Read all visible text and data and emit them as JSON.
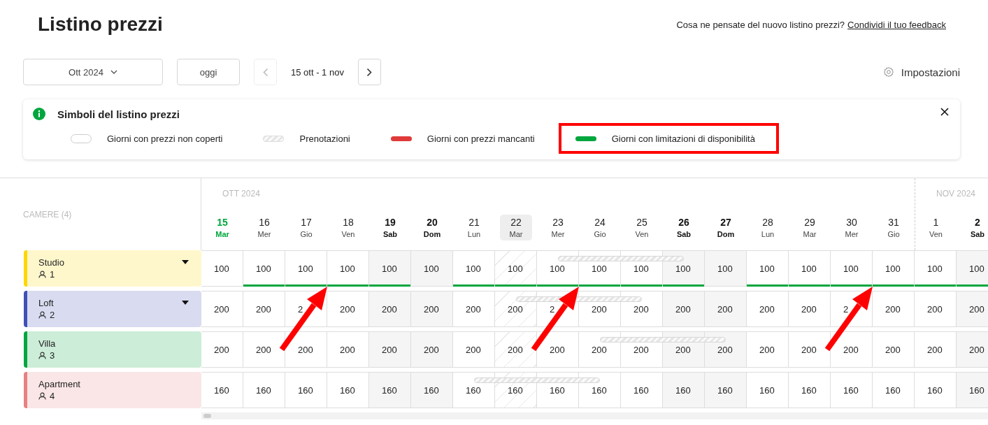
{
  "page": {
    "title": "Listino prezzi",
    "feedback_question": "Cosa ne pensate del nuovo listino prezzi?",
    "feedback_link": "Condividi il tuo feedback"
  },
  "toolbar": {
    "month": "Ott 2024",
    "today_button": "oggi",
    "prev_disabled": true,
    "range": "15 ott - 1 nov",
    "settings": "Impostazioni"
  },
  "legend": {
    "title": "Simboli del listino prezzi",
    "items": [
      {
        "kind": "uncovered",
        "label": "Giorni con prezzi non coperti",
        "highlighted": false
      },
      {
        "kind": "booking",
        "label": "Prenotazioni",
        "highlighted": false
      },
      {
        "kind": "missing",
        "label": "Giorni con prezzi mancanti",
        "highlighted": false
      },
      {
        "kind": "restricted",
        "label": "Giorni con limitazioni di disponibilità",
        "highlighted": true
      }
    ]
  },
  "grid": {
    "rooms_header": "CAMERE (4)",
    "days": [
      {
        "month": "OTT 2024",
        "day": "15",
        "weekday": "Mar",
        "kind": "today",
        "selected": false
      },
      {
        "day": "16",
        "weekday": "Mer",
        "kind": "weekday",
        "selected": false
      },
      {
        "day": "17",
        "weekday": "Gio",
        "kind": "weekday",
        "selected": false
      },
      {
        "day": "18",
        "weekday": "Ven",
        "kind": "weekday",
        "selected": false
      },
      {
        "day": "19",
        "weekday": "Sab",
        "kind": "weekend",
        "selected": false
      },
      {
        "day": "20",
        "weekday": "Dom",
        "kind": "weekend",
        "selected": false
      },
      {
        "day": "21",
        "weekday": "Lun",
        "kind": "weekday",
        "selected": false
      },
      {
        "day": "22",
        "weekday": "Mar",
        "kind": "weekday",
        "selected": true
      },
      {
        "day": "23",
        "weekday": "Mer",
        "kind": "weekday",
        "selected": false
      },
      {
        "day": "24",
        "weekday": "Gio",
        "kind": "weekday",
        "selected": false
      },
      {
        "day": "25",
        "weekday": "Ven",
        "kind": "weekday",
        "selected": false
      },
      {
        "day": "26",
        "weekday": "Sab",
        "kind": "weekend",
        "selected": false
      },
      {
        "day": "27",
        "weekday": "Dom",
        "kind": "weekend",
        "selected": false
      },
      {
        "day": "28",
        "weekday": "Lun",
        "kind": "weekday",
        "selected": false
      },
      {
        "day": "29",
        "weekday": "Mar",
        "kind": "weekday",
        "selected": false
      },
      {
        "day": "30",
        "weekday": "Mer",
        "kind": "weekday",
        "selected": false
      },
      {
        "day": "31",
        "weekday": "Gio",
        "kind": "weekday",
        "selected": false
      },
      {
        "month": "NOV 2024",
        "day": "1",
        "weekday": "Ven",
        "kind": "weekday",
        "selected": false
      },
      {
        "day": "2",
        "weekday": "Sab",
        "kind": "weekend",
        "selected": false
      }
    ],
    "rooms": [
      {
        "name": "Studio",
        "guests": "1",
        "color": "#ffd600",
        "expandable": true,
        "cells": [
          {
            "price": "100",
            "restricted": false
          },
          {
            "price": "100",
            "restricted": true
          },
          {
            "price": "100",
            "restricted": true,
            "arrow": true
          },
          {
            "price": "100",
            "restricted": true
          },
          {
            "price": "100",
            "restricted": true
          },
          {
            "price": "100",
            "restricted": false
          },
          {
            "price": "100",
            "restricted": true
          },
          {
            "price": "100",
            "restricted": true
          },
          {
            "price": "100",
            "restricted": true,
            "booked_night": true,
            "arrow": true
          },
          {
            "price": "100",
            "restricted": true,
            "booked_night": true
          },
          {
            "price": "100",
            "restricted": true,
            "booked_night": true
          },
          {
            "price": "100",
            "restricted": true
          },
          {
            "price": "100",
            "restricted": false
          },
          {
            "price": "100",
            "restricted": true
          },
          {
            "price": "100",
            "restricted": true
          },
          {
            "price": "100",
            "restricted": true,
            "arrow": true
          },
          {
            "price": "100",
            "restricted": true
          },
          {
            "price": "100",
            "restricted": true
          },
          {
            "price": "100",
            "restricted": true
          }
        ]
      },
      {
        "name": "Loft",
        "guests": "2",
        "color": "#3f51b5",
        "expandable": true,
        "cells": [
          {
            "price": "200"
          },
          {
            "price": "200"
          },
          {
            "price": "2"
          },
          {
            "price": "200"
          },
          {
            "price": "200"
          },
          {
            "price": "200"
          },
          {
            "price": "200"
          },
          {
            "price": "200",
            "booked_night": true
          },
          {
            "price": "2",
            "booked_night": true
          },
          {
            "price": "200",
            "booked_night": true
          },
          {
            "price": "200"
          },
          {
            "price": "200"
          },
          {
            "price": "200"
          },
          {
            "price": "200"
          },
          {
            "price": "200"
          },
          {
            "price": "2"
          },
          {
            "price": "200"
          },
          {
            "price": "200"
          },
          {
            "price": "200"
          }
        ]
      },
      {
        "name": "Villa",
        "guests": "3",
        "color": "#00a63e",
        "expandable": false,
        "cells": [
          {
            "price": "200"
          },
          {
            "price": "200"
          },
          {
            "price": "200"
          },
          {
            "price": "200"
          },
          {
            "price": "200"
          },
          {
            "price": "200"
          },
          {
            "price": "200"
          },
          {
            "price": "200"
          },
          {
            "price": "200"
          },
          {
            "price": "200",
            "booked_night": true
          },
          {
            "price": "200",
            "booked_night": true
          },
          {
            "price": "200",
            "booked_night": true
          },
          {
            "price": "200"
          },
          {
            "price": "200"
          },
          {
            "price": "200"
          },
          {
            "price": "200"
          },
          {
            "price": "200"
          },
          {
            "price": "200"
          },
          {
            "price": "200"
          }
        ]
      },
      {
        "name": "Apartment",
        "guests": "4",
        "color": "#e88080",
        "expandable": false,
        "cells": [
          {
            "price": "160"
          },
          {
            "price": "160"
          },
          {
            "price": "160"
          },
          {
            "price": "160"
          },
          {
            "price": "160"
          },
          {
            "price": "160"
          },
          {
            "price": "160",
            "booked_night": true
          },
          {
            "price": "160",
            "booked_night": true
          },
          {
            "price": "160",
            "booked_night": true
          },
          {
            "price": "160"
          },
          {
            "price": "160"
          },
          {
            "price": "160"
          },
          {
            "price": "160"
          },
          {
            "price": "160"
          },
          {
            "price": "160"
          },
          {
            "price": "160"
          },
          {
            "price": "160"
          },
          {
            "price": "160"
          },
          {
            "price": "160"
          }
        ]
      }
    ]
  }
}
